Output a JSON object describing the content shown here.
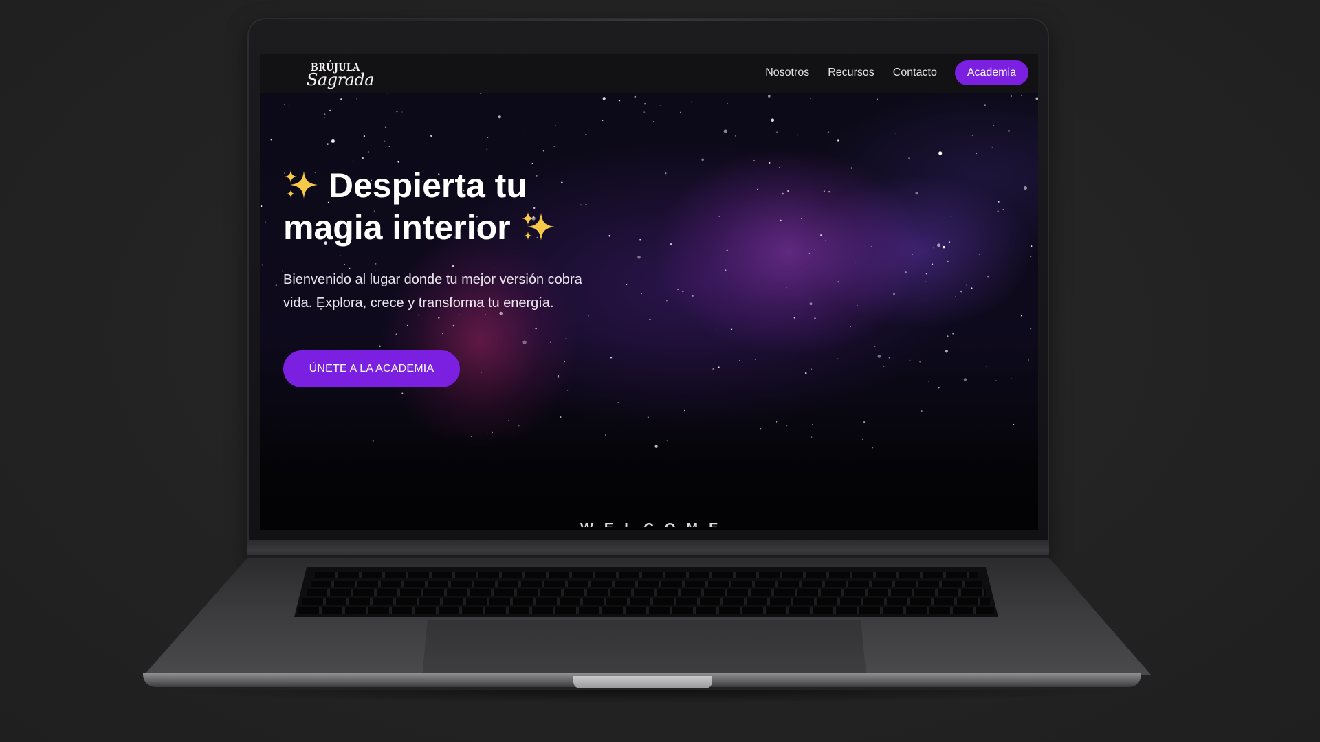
{
  "site": {
    "logo": {
      "line1": "BRÚJULA",
      "line2": "Sagrada"
    },
    "nav": {
      "links": [
        "Nosotros",
        "Recursos",
        "Contacto"
      ],
      "cta": "Academia"
    },
    "hero": {
      "title_line1": "Despierta tu",
      "title_line2": "magia interior",
      "sparkle_icon": "sparkles-icon",
      "subtitle": "Bienvenido al lugar donde tu mejor versión cobra vida. Explora, crece y transforma tu energía.",
      "button": "ÚNETE A LA ACADEMIA"
    },
    "next_section_peek": "WELCOME"
  },
  "colors": {
    "accent": "#7b1fe0",
    "nav_background": "#121214",
    "sparkle": "#f7c948",
    "page_background": "#232323"
  }
}
